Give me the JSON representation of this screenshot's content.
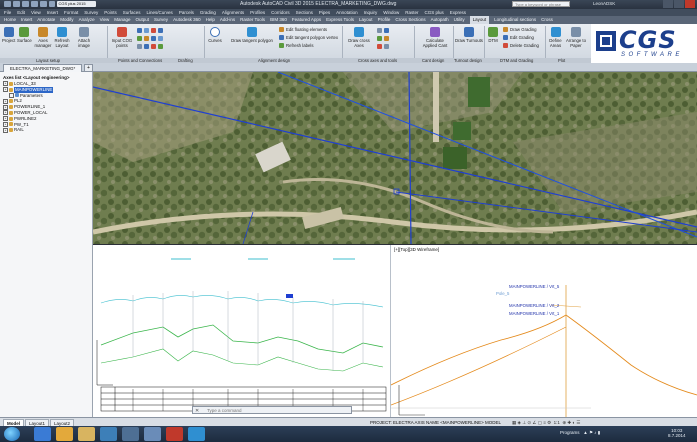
{
  "window": {
    "title": "Autodesk AutoCAD Civil 3D 2015   ELECTRA_MARKETING_DWG.dwg",
    "search_placeholder": "Type a keyword or phrase",
    "user": "LeonADSK",
    "workspace": "CGS plus 2015"
  },
  "menubar": [
    "File",
    "Edit",
    "View",
    "Insert",
    "Format",
    "Survey",
    "Points",
    "Surfaces",
    "Lines/Curves",
    "Parcels",
    "Grading",
    "Alignments",
    "Profiles",
    "Corridors",
    "Sections",
    "Pipes",
    "Annotation",
    "Inquiry",
    "Window",
    "Raster",
    "CGS plus",
    "Express"
  ],
  "tabs": [
    "Home",
    "Insert",
    "Annotate",
    "Modify",
    "Analyze",
    "View",
    "Manage",
    "Output",
    "Survey",
    "Autodesk 360",
    "Help",
    "Add-ins",
    "Raster Tools",
    "BIM 360",
    "Featured Apps",
    "Express Tools",
    "Layout",
    "Profile",
    "Cross Sections",
    "Autopath",
    "Utility",
    "Layout",
    "Longitudinal sections",
    "Cross"
  ],
  "active_tab_index": 21,
  "ribbon": {
    "buttons": [
      "Project",
      "Surface",
      "Axes manager",
      "Refresh Layout",
      "Attach image",
      "Input COG points",
      "Curves",
      "Draw tangent polygon",
      "Draw cross Axes",
      "Calculate Applied Cant",
      "Draw Turnouts",
      "DTM",
      "Define Areas",
      "Arrange to Paper"
    ],
    "small_items": [
      "Edit floating elements",
      "Edit tangent polygon vertex",
      "Refresh labels",
      "Draw Grading",
      "Edit Grading",
      "Delete Grading"
    ],
    "panels": [
      "Layout setup",
      "Points and Connections",
      "Drafting",
      "Alignment design",
      "Cross axes and tools",
      "Cant design",
      "Turnout design",
      "DTM and Grading",
      "Plot",
      "Refresh and tools"
    ]
  },
  "logo": {
    "name": "CGS",
    "sub": "SOFTWARE"
  },
  "doc_tab": "ELECTRA_MARKETING_DWG*",
  "axes_panel": {
    "header": "Axes list <Layout engineering>",
    "items": [
      {
        "label": "LOCAL_33",
        "level": 0,
        "selected": false
      },
      {
        "label": "MAINPOWERLINE",
        "level": 0,
        "selected": true
      },
      {
        "label": "Parameters",
        "level": 1,
        "selected": false
      },
      {
        "label": "PL2",
        "level": 0,
        "selected": false
      },
      {
        "label": "POWERLINE_1",
        "level": 0,
        "selected": false
      },
      {
        "label": "POWER_LOCAL",
        "level": 0,
        "selected": false
      },
      {
        "label": "PWRLINE2",
        "level": 0,
        "selected": false
      },
      {
        "label": "PW_T1",
        "level": 0,
        "selected": false
      },
      {
        "label": "RAIL",
        "level": 0,
        "selected": false
      }
    ]
  },
  "plan_view": {
    "label": "[+][Top][3D Wireframe]",
    "annotations": [
      "MAINPOWERLINE / Vrt_5",
      "Pole_5",
      "MAINPOWERLINE / Vrt_2",
      "MAINPOWERLINE / Vrt_1"
    ]
  },
  "command": {
    "placeholder": "Type a command"
  },
  "layout_tabs": [
    "Model",
    "Layout1",
    "Layout2"
  ],
  "status": {
    "info": "PROJECT: ELECTRA  AXIS NAME <MAINPOWERLINE>  MODEL",
    "scale": "1:1",
    "clock_time": "10:03",
    "clock_date": "8.7.2014",
    "tray_text": "Programs"
  },
  "colors": {
    "accent": "#1c3f8c",
    "selection": "#2c66c7",
    "alignment": "#1f3fd1",
    "ground_line": "#39b54a",
    "grid_line": "#e48a1c"
  }
}
